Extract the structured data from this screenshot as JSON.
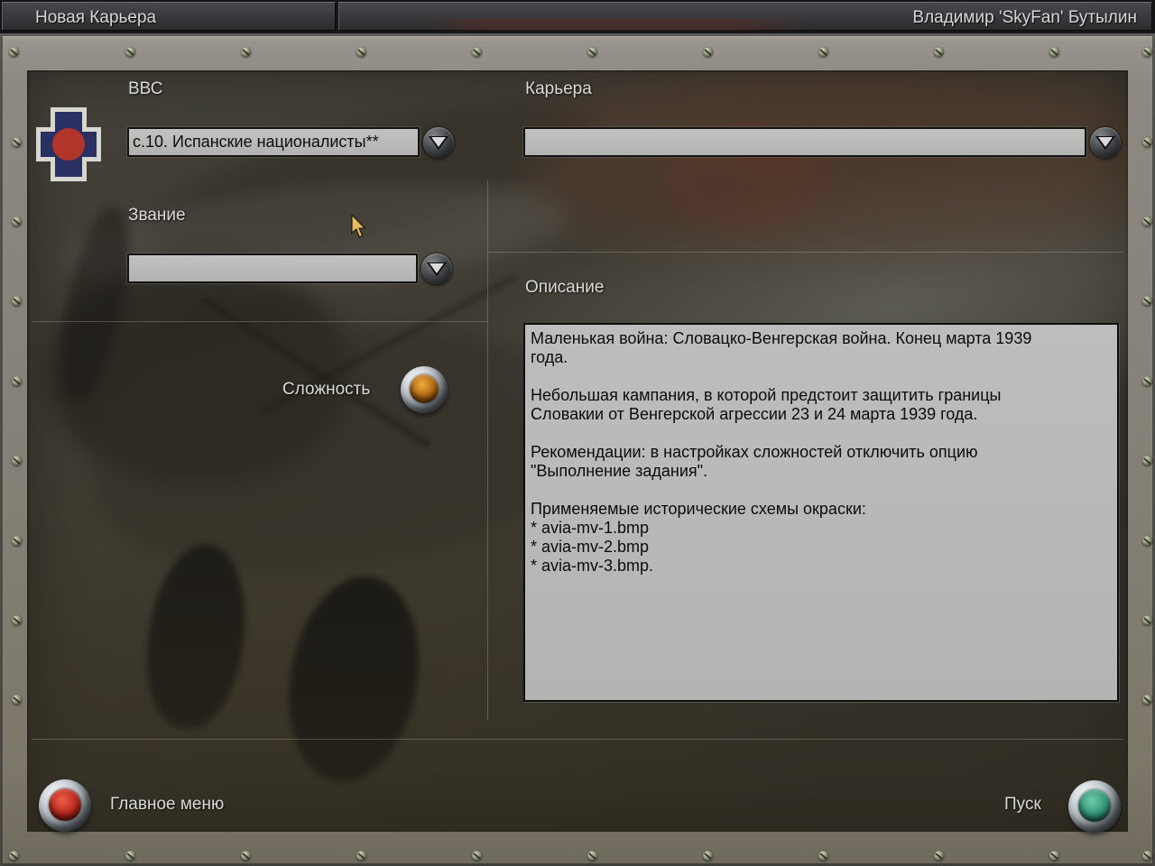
{
  "window": {
    "tab_title": "Новая Карьера",
    "pilot_name": "Владимир 'SkyFan' Бутылин"
  },
  "form": {
    "air_force": {
      "label": "ВВС",
      "value": "с.10. Испанские националисты**"
    },
    "career": {
      "label": "Карьера",
      "value": ""
    },
    "rank": {
      "label": "Звание",
      "value": ""
    },
    "difficulty": {
      "label": "Сложность"
    },
    "description": {
      "label": "Описание",
      "paragraphs": [
        "Маленькая война: Словацко-Венгерская война. Конец марта 1939\nгода.",
        "Небольшая кампания, в которой предстоит защитить границы\nСловакии от Венгерской агрессии 23 и 24 марта 1939 года.",
        "Рекомендации: в настройках сложностей отключить опцию\n\"Выполнение задания\".",
        "Применяемые исторические схемы окраски:\n* avia-mv-1.bmp\n* avia-mv-2.bmp\n* avia-mv-3.bmp."
      ]
    }
  },
  "footer": {
    "main_menu_label": "Главное меню",
    "start_label": "Пуск"
  },
  "insignia": {
    "name": "slovak-air-force-roundel",
    "cross_color": "#2b3063",
    "circle_color": "#b1352a",
    "border_color": "#d7d7d1"
  },
  "buttons": {
    "difficulty_lamp_color": "#b06a16",
    "main_menu_lamp_color": "#c03226",
    "start_lamp_color": "#2f9378"
  }
}
